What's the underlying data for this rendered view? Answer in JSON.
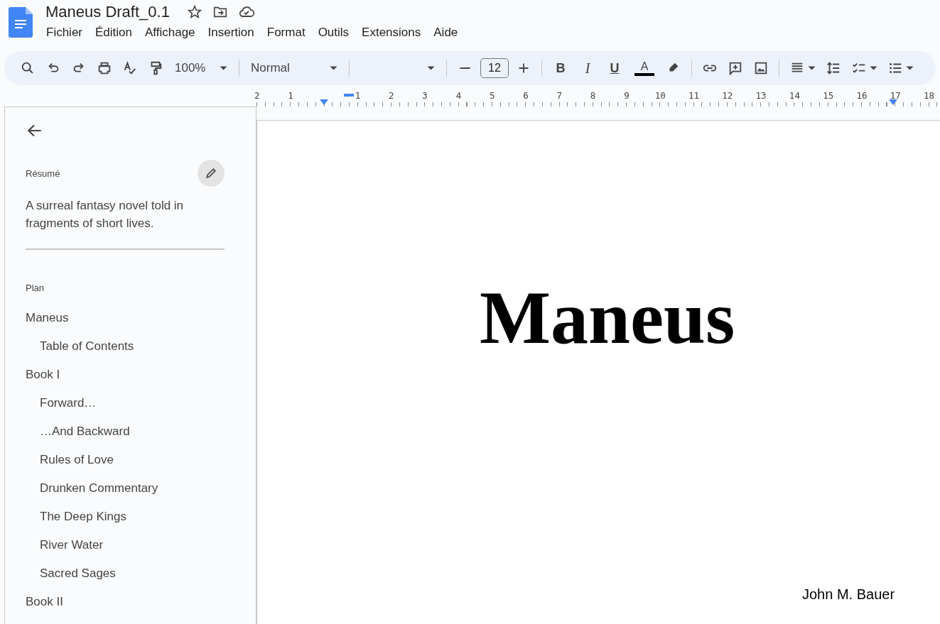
{
  "document_title": "Maneus Draft_0.1",
  "menu": [
    "Fichier",
    "Édition",
    "Affichage",
    "Insertion",
    "Format",
    "Outils",
    "Extensions",
    "Aide"
  ],
  "toolbar": {
    "zoom": "100%",
    "style": "Normal",
    "font_size": "12",
    "format_glyphs": [
      "B",
      "I",
      "U",
      "A"
    ]
  },
  "ruler": {
    "left_labels": [
      "2",
      "1"
    ],
    "right_labels": [
      "1",
      "2",
      "3",
      "4",
      "5",
      "6",
      "7",
      "8",
      "9",
      "10",
      "11",
      "12",
      "13",
      "14",
      "15",
      "16",
      "17",
      "18"
    ]
  },
  "sidebar": {
    "summary_label": "Résumé",
    "summary": "A surreal fantasy novel told in fragments of short lives.",
    "outline_label": "Plan",
    "outline": [
      {
        "title": "Maneus",
        "children": [
          {
            "title": "Table of Contents"
          }
        ]
      },
      {
        "title": "Book I",
        "children": [
          {
            "title": "Forward…"
          },
          {
            "title": "…And Backward"
          },
          {
            "title": "Rules of Love"
          },
          {
            "title": "Drunken Commentary"
          },
          {
            "title": "The Deep Kings"
          },
          {
            "title": "River Water"
          },
          {
            "title": "Sacred Sages"
          }
        ]
      },
      {
        "title": "Book II"
      }
    ]
  },
  "page": {
    "title": "Maneus",
    "author": "John M. Bauer"
  }
}
